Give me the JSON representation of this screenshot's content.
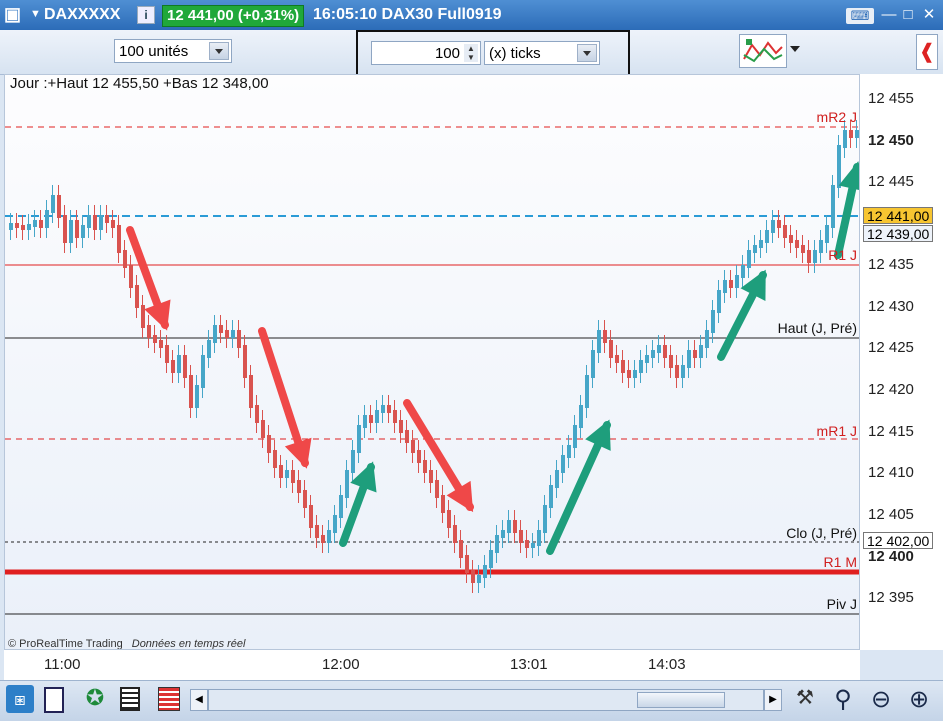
{
  "titlebar": {
    "instrument": "DAXXXXX",
    "price_change": "12 441,00 (+0,31%)",
    "time_symbol": "16:05:10 DAX30 Full0919"
  },
  "toolbar": {
    "units_select": "100 unités",
    "ticks_value": "100",
    "ticks_select": "(x) ticks"
  },
  "chart": {
    "header": "Jour :+Haut 12 455,50 +Bas 12 348,00",
    "footer_brand": "© ProRealTime Trading",
    "footer_note": "Données en temps réel",
    "line_labels": {
      "mr2": "mR2 J",
      "r1": "R1 J",
      "haut": "Haut (J, Pré)",
      "mr1": "mR1 J",
      "clo": "Clo (J, Pré)",
      "r1m": "R1 M",
      "piv": "Piv J"
    },
    "colors": {
      "up": "#46a6c8",
      "down": "#d9534f",
      "red": "#e02020",
      "blue": "#2a9bd6",
      "arrow_red": "#ef4848",
      "arrow_green": "#1e9e7c"
    }
  },
  "price_axis": {
    "ticks": [
      "12 455",
      "12 450",
      "12 445",
      "12 435",
      "12 430",
      "12 425",
      "12 420",
      "12 415",
      "12 410",
      "12 405",
      "12 400",
      "12 395"
    ],
    "current_price": "12 441,00",
    "bid_price": "12 439,00",
    "clo_price": "12 402,00"
  },
  "time_axis": {
    "ticks": [
      "11:00",
      "12:00",
      "13:01",
      "14:03"
    ]
  }
}
